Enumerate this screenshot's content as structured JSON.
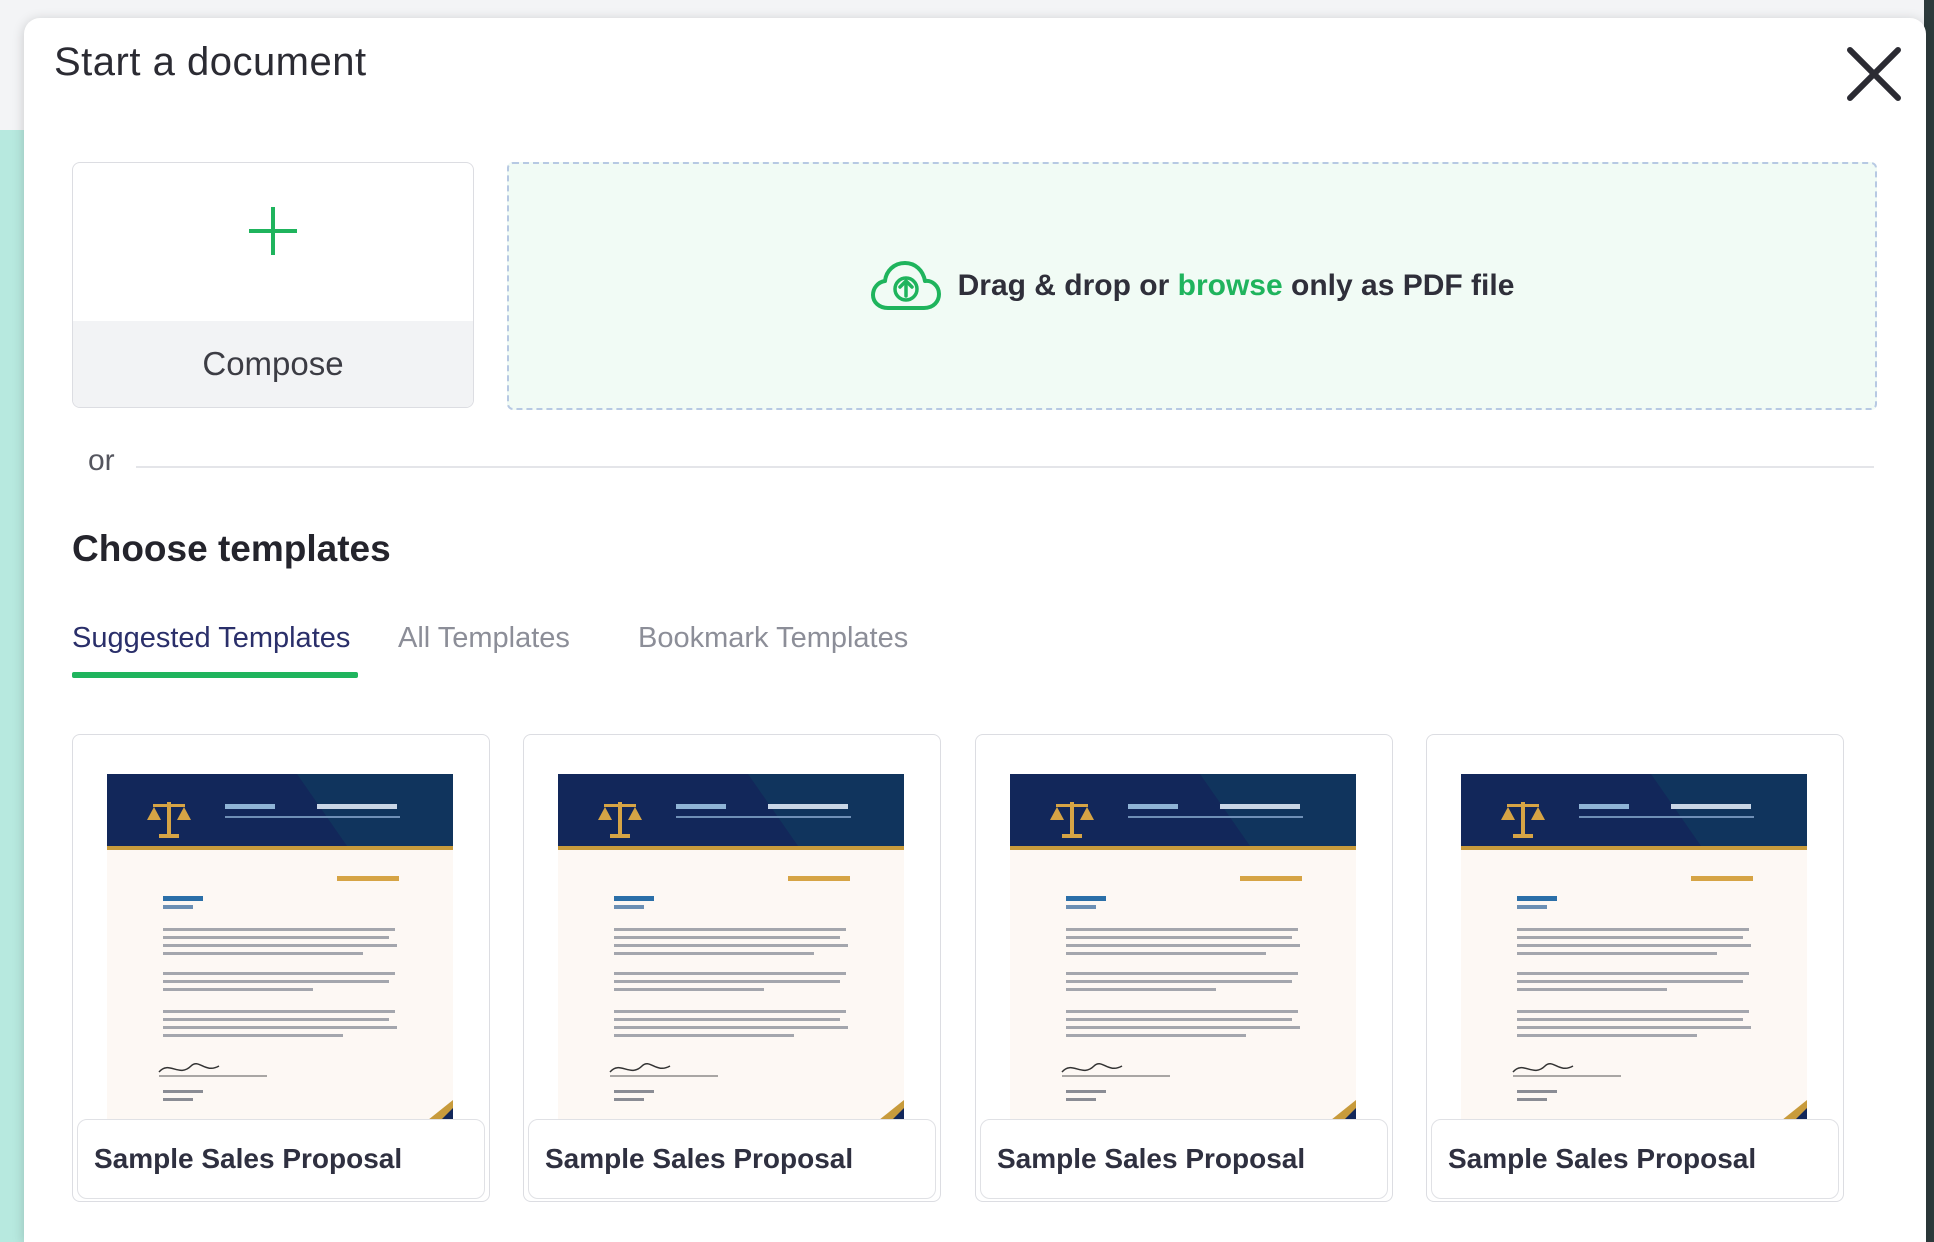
{
  "modal": {
    "title": "Start a document",
    "close_icon": "close-icon"
  },
  "compose": {
    "icon": "plus-icon",
    "label": "Compose"
  },
  "upload": {
    "icon": "cloud-upload-icon",
    "text_before": "Drag & drop or",
    "link": "browse",
    "text_after": "only as PDF file"
  },
  "divider": {
    "label": "or"
  },
  "templates": {
    "heading": "Choose templates",
    "tabs": [
      {
        "label": "Suggested Templates",
        "active": true
      },
      {
        "label": "All Templates",
        "active": false
      },
      {
        "label": "Bookmark Templates",
        "active": false
      }
    ],
    "cards": [
      {
        "title": "Sample Sales Proposal"
      },
      {
        "title": "Sample Sales Proposal"
      },
      {
        "title": "Sample Sales Proposal"
      },
      {
        "title": "Sample Sales Proposal"
      }
    ]
  },
  "colors": {
    "accent": "#1fb45d",
    "backdrop": "#b7e9df",
    "tab_active": "#2a2f6a",
    "tab_inactive": "#8c8e98"
  }
}
